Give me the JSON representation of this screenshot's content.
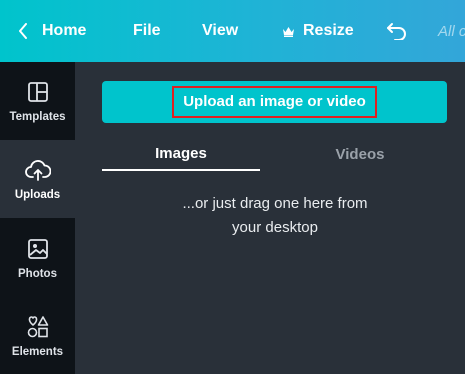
{
  "topbar": {
    "home_label": "Home",
    "file_label": "File",
    "view_label": "View",
    "resize_label": "Resize",
    "saved_label": "All c"
  },
  "sidebar": {
    "items": [
      {
        "label": "Templates",
        "icon": "templates-icon"
      },
      {
        "label": "Uploads",
        "icon": "upload-cloud-icon",
        "active": true
      },
      {
        "label": "Photos",
        "icon": "photo-icon"
      },
      {
        "label": "Elements",
        "icon": "shapes-icon"
      }
    ]
  },
  "main": {
    "upload_button": "Upload an image or video",
    "tabs": [
      {
        "label": "Images",
        "active": true
      },
      {
        "label": "Videos",
        "active": false
      }
    ],
    "drag_hint_line1": "...or just drag one here from",
    "drag_hint_line2": "your desktop"
  },
  "colors": {
    "accent": "#00c4cc",
    "panel": "#293039",
    "sidebar": "#0e1318",
    "highlight": "#e02020"
  }
}
